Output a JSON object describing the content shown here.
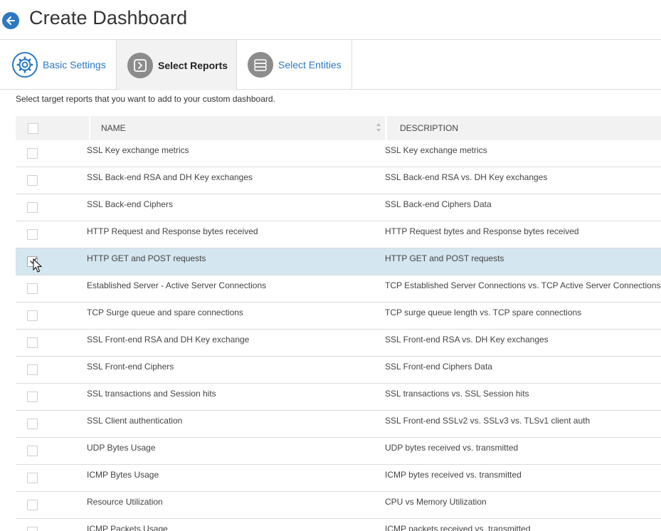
{
  "page": {
    "title": "Create Dashboard",
    "instruction": "Select target reports that you want to add to your custom dashboard."
  },
  "tabs": [
    {
      "label": "Basic Settings",
      "icon": "gear-icon",
      "active": false
    },
    {
      "label": "Select Reports",
      "icon": "chevron-right-icon",
      "active": true
    },
    {
      "label": "Select Entities",
      "icon": "server-icon",
      "active": false
    }
  ],
  "table": {
    "columns": [
      "NAME",
      "DESCRIPTION"
    ],
    "rows": [
      {
        "name": "SSL Key exchange metrics",
        "description": "SSL Key exchange metrics",
        "checked": false
      },
      {
        "name": "SSL Back-end RSA and DH Key exchanges",
        "description": "SSL Back-end RSA vs. DH Key exchanges",
        "checked": false
      },
      {
        "name": "SSL Back-end Ciphers",
        "description": "SSL Back-end Ciphers Data",
        "checked": false
      },
      {
        "name": "HTTP Request and Response bytes received",
        "description": "HTTP Request bytes and Response bytes received",
        "checked": false
      },
      {
        "name": "HTTP GET and POST requests",
        "description": "HTTP GET and POST requests",
        "checked": true
      },
      {
        "name": "Established Server - Active Server Connections",
        "description": "TCP Established Server Connections vs. TCP Active Server Connections",
        "checked": false
      },
      {
        "name": "TCP Surge queue and spare connections",
        "description": "TCP surge queue length vs. TCP spare connections",
        "checked": false
      },
      {
        "name": "SSL Front-end RSA and DH Key exchange",
        "description": "SSL Front-end RSA vs. DH Key exchanges",
        "checked": false
      },
      {
        "name": "SSL Front-end Ciphers",
        "description": "SSL Front-end Ciphers Data",
        "checked": false
      },
      {
        "name": "SSL transactions and Session hits",
        "description": "SSL transactions vs. SSL Session hits",
        "checked": false
      },
      {
        "name": "SSL Client authentication",
        "description": "SSL Front-end SSLv2 vs. SSLv3 vs. TLSv1 client auth",
        "checked": false
      },
      {
        "name": "UDP Bytes Usage",
        "description": "UDP bytes received vs. transmitted",
        "checked": false
      },
      {
        "name": "ICMP Bytes Usage",
        "description": "ICMP bytes received vs. transmitted",
        "checked": false
      },
      {
        "name": "Resource Utilization",
        "description": "CPU vs Memory Utilization",
        "checked": false
      },
      {
        "name": "ICMP Packets Usage",
        "description": "ICMP packets received vs. transmitted",
        "checked": false
      }
    ]
  },
  "colors": {
    "accent": "#2a79c2",
    "selected_row": "#d4e6f0",
    "header_bg": "#f2f2f2"
  }
}
